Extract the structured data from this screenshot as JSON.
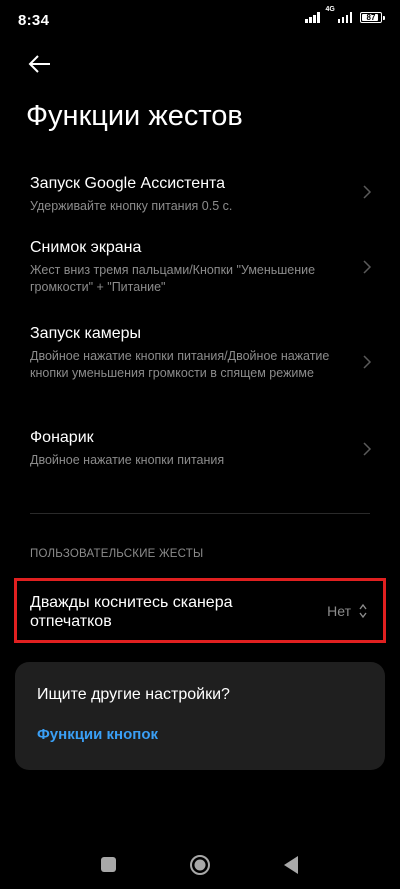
{
  "status_bar": {
    "time": "8:34",
    "network": "4G",
    "battery": "87"
  },
  "header": {
    "title": "Функции жестов"
  },
  "settings": [
    {
      "title": "Запуск Google Ассистента",
      "subtitle": "Удерживайте кнопку питания 0.5 с."
    },
    {
      "title": "Снимок экрана",
      "subtitle": "Жест вниз тремя пальцами/Кнопки \"Уменьшение громкости\" + \"Питание\""
    },
    {
      "title": "Запуск камеры",
      "subtitle": "Двойное нажатие кнопки питания/Двойное нажатие кнопки уменьшения громкости в спящем режиме"
    },
    {
      "title": "Фонарик",
      "subtitle": "Двойное нажатие кнопки питания"
    }
  ],
  "custom_section": {
    "header": "ПОЛЬЗОВАТЕЛЬСКИЕ ЖЕСТЫ",
    "item": {
      "title": "Дважды коснитесь сканера отпечатков",
      "value": "Нет"
    },
    "highlight_color": "#e02020"
  },
  "card": {
    "question": "Ищите другие настройки?",
    "link": "Функции кнопок",
    "link_color": "#3a9ff5"
  },
  "icons": {
    "back": "arrow-left-icon",
    "chevron": "chevron-right-icon",
    "selector": "up-down-arrows-icon",
    "nav_recent": "square-icon",
    "nav_home": "circle-icon",
    "nav_back": "triangle-icon"
  }
}
